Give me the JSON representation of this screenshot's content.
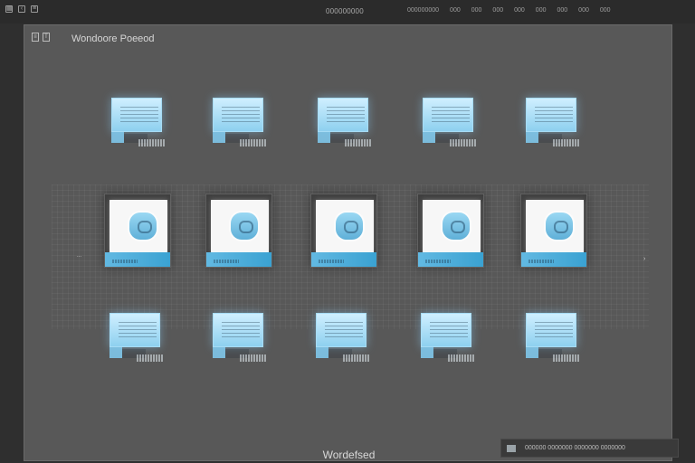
{
  "topbar": {
    "title": "000000000",
    "menu": [
      "000000000",
      "000",
      "000",
      "000",
      "000",
      "000",
      "000",
      "000",
      "000"
    ],
    "icons": [
      "grid-icon",
      "back-icon",
      "menu-icon"
    ]
  },
  "panel": {
    "title": "Wondoore Poeeod",
    "icons": [
      "list-icon",
      "text-icon"
    ]
  },
  "sidebar": {
    "left_label": "...",
    "right_label": "›"
  },
  "footer": {
    "label": "Wordefsed"
  },
  "bottom_tip": {
    "text": "000000  0000000  0000000  0000000"
  },
  "colors": {
    "background": "#2f2f2f",
    "panel": "#585858",
    "accent": "#62b9e2",
    "card": "#3f3f3f"
  }
}
